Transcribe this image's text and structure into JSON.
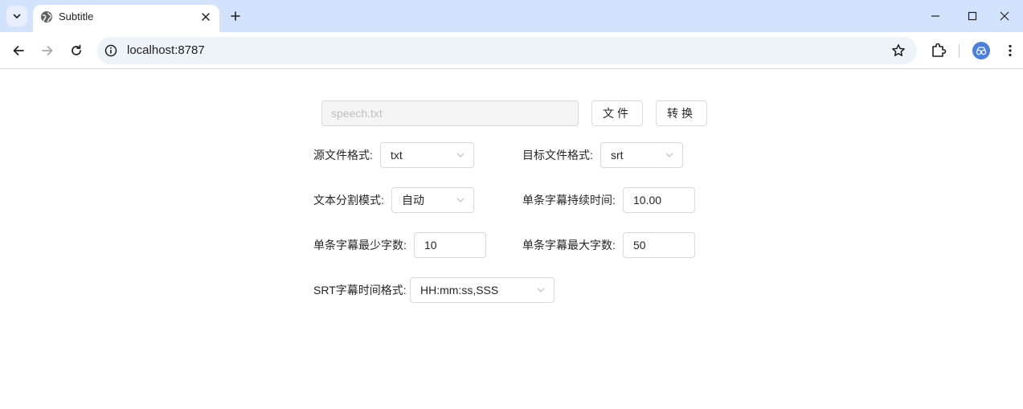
{
  "browser": {
    "tab_title": "Subtitle",
    "url": "localhost:8787",
    "icons": {
      "tab_menu": "chevron-down-icon",
      "favicon": "globe-icon",
      "close": "close-icon",
      "new_tab": "plus-icon",
      "back": "arrow-left-icon",
      "forward": "arrow-right-icon",
      "reload": "reload-icon",
      "info": "info-icon",
      "bookmark": "star-icon",
      "extensions": "puzzle-icon",
      "profile": "avatar-icon",
      "menu": "kebab-menu-icon"
    }
  },
  "form": {
    "file_placeholder": "speech.txt",
    "file_button": "文件",
    "convert_button": "转换",
    "source_format_label": "源文件格式:",
    "source_format_value": "txt",
    "target_format_label": "目标文件格式:",
    "target_format_value": "srt",
    "split_mode_label": "文本分割模式:",
    "split_mode_value": "自动",
    "duration_label": "单条字幕持续时间:",
    "duration_value": "10.00",
    "min_chars_label": "单条字幕最少字数:",
    "min_chars_value": "10",
    "max_chars_label": "单条字幕最大字数:",
    "max_chars_value": "50",
    "srt_time_format_label": "SRT字幕时间格式:",
    "srt_time_format_value": "HH:mm:ss,SSS"
  }
}
